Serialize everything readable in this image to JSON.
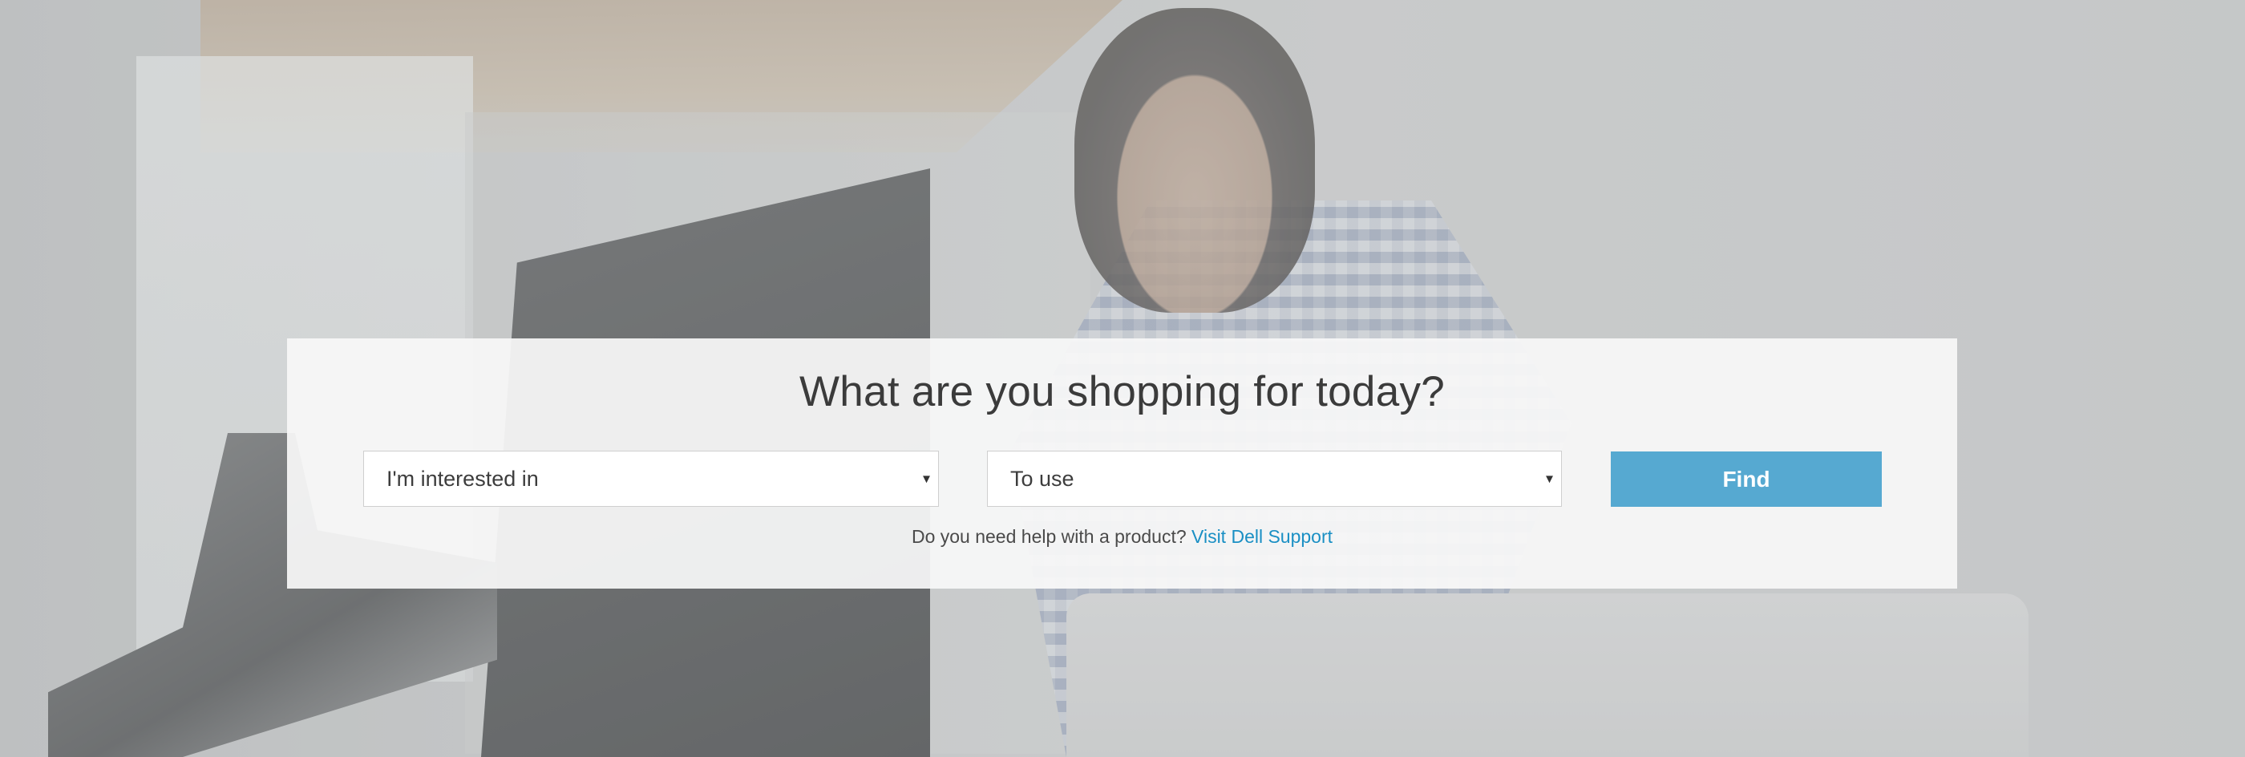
{
  "hero": {
    "title": "What are you shopping for today?",
    "select_interest": {
      "value": "I'm interested in",
      "arrow": "▾"
    },
    "select_use": {
      "value": "To use",
      "arrow": "▾"
    },
    "find_button": "Find",
    "help_text": "Do you need help with a product?",
    "help_link": "Visit Dell Support"
  },
  "colors": {
    "find_button_bg": "#56a9d1",
    "link": "#1a8fc4",
    "panel_bg": "#f7f7f7",
    "title_text": "#3b3b3b"
  },
  "icons": {
    "select_arrow": "triangle-down-icon"
  }
}
